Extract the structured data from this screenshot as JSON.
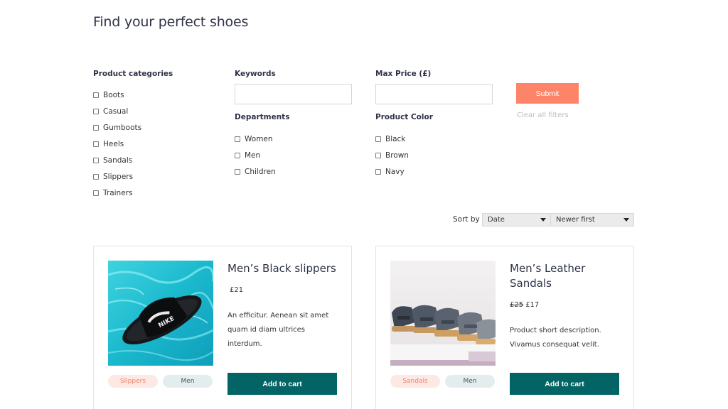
{
  "page": {
    "title": "Find your perfect shoes"
  },
  "filters": {
    "categories": {
      "label": "Product categories",
      "items": [
        "Boots",
        "Casual",
        "Gumboots",
        "Heels",
        "Sandals",
        "Slippers",
        "Trainers"
      ]
    },
    "keywords": {
      "label": "Keywords",
      "value": "",
      "placeholder": ""
    },
    "max_price": {
      "label": "Max Price (£)",
      "value": "",
      "placeholder": ""
    },
    "departments": {
      "label": "Departments",
      "items": [
        "Women",
        "Men",
        "Children"
      ]
    },
    "colors": {
      "label": "Product Color",
      "items": [
        "Black",
        "Brown",
        "Navy"
      ]
    },
    "submit_label": "Submit",
    "clear_label": "Clear all filters"
  },
  "sort": {
    "label": "Sort by",
    "field": "Date",
    "order": "Newer first"
  },
  "products": [
    {
      "title": "Men’s Black slippers",
      "old_price": "",
      "price": "£21",
      "description": "An efficitur. Aenean sit amet quam id diam ultrices interdum.",
      "category_tag": "Slippers",
      "department_tag": "Men",
      "cart_label": "Add to cart",
      "image_icon": "slipper-photo-icon"
    },
    {
      "title": "Men’s Leather Sandals",
      "old_price": "£25",
      "price": "£17",
      "description": "Product short description. Vivamus consequat velit.",
      "category_tag": "Sandals",
      "department_tag": "Men",
      "cart_label": "Add to cart",
      "image_icon": "sandals-photo-icon"
    }
  ],
  "colors": {
    "accent": "#fd8469",
    "primary": "#026465",
    "title": "#2f3347"
  }
}
